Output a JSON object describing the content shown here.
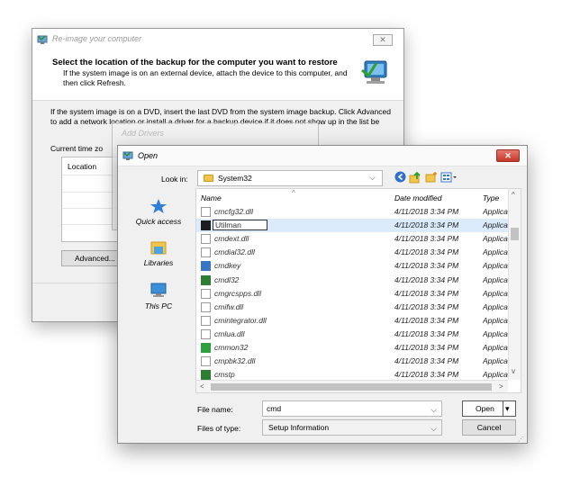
{
  "wizard": {
    "title": "Re-image your computer",
    "heading": "Select the location of the backup for the computer you want to restore",
    "subheading": "If the system image is on an external device, attach the device to this computer, and then click Refresh.",
    "body_text": "If the system image is on a DVD, insert the last DVD from the system image backup. Click Advanced to add a network location or install a driver for a backup device if it does not show up in the list be",
    "current_time_zone_label": "Current time zo",
    "location_header": "Location",
    "advanced_label": "Advanced..."
  },
  "add_drivers": {
    "title": "Add Drivers"
  },
  "open_dialog": {
    "title": "Open",
    "look_in_label": "Look in:",
    "look_in_value": "System32",
    "places": [
      {
        "label": "Quick access",
        "icon": "star-pin-icon"
      },
      {
        "label": "Libraries",
        "icon": "libraries-folder-icon"
      },
      {
        "label": "This PC",
        "icon": "computer-icon"
      }
    ],
    "columns": {
      "name": "Name",
      "date": "Date modified",
      "type": "Type"
    },
    "files": [
      {
        "name": "cmcfg32.dll",
        "date": "4/11/2018 3:34 PM",
        "type": "Application extension",
        "icon": "dll-file-icon"
      },
      {
        "name": "Utilman",
        "date": "4/11/2018 3:34 PM",
        "type": "Application",
        "icon": "console-icon"
      },
      {
        "name": "cmdext.dll",
        "date": "4/11/2018 3:34 PM",
        "type": "Application extension",
        "icon": "dll-file-icon"
      },
      {
        "name": "cmdial32.dll",
        "date": "4/11/2018 3:34 PM",
        "type": "Application extension",
        "icon": "dll-file-icon"
      },
      {
        "name": "cmdkey",
        "date": "4/11/2018 3:34 PM",
        "type": "Application",
        "icon": "exe-window-icon"
      },
      {
        "name": "cmdl32",
        "date": "4/11/2018 3:34 PM",
        "type": "Application",
        "icon": "cmdl32-icon"
      },
      {
        "name": "cmgrcspps.dll",
        "date": "4/11/2018 3:34 PM",
        "type": "Application extension",
        "icon": "dll-file-icon"
      },
      {
        "name": "cmifw.dll",
        "date": "4/11/2018 3:34 PM",
        "type": "Application extension",
        "icon": "dll-file-icon"
      },
      {
        "name": "cmintegrator.dll",
        "date": "4/11/2018 3:34 PM",
        "type": "Application extension",
        "icon": "dll-file-icon"
      },
      {
        "name": "cmlua.dll",
        "date": "4/11/2018 3:34 PM",
        "type": "Application extension",
        "icon": "dll-file-icon"
      },
      {
        "name": "cmmon32",
        "date": "4/11/2018 3:34 PM",
        "type": "Application",
        "icon": "cmmon-icon"
      },
      {
        "name": "cmpbk32.dll",
        "date": "4/11/2018 3:34 PM",
        "type": "Application extension",
        "icon": "dll-file-icon"
      },
      {
        "name": "cmstp",
        "date": "4/11/2018 3:34 PM",
        "type": "Application",
        "icon": "cmstp-icon"
      }
    ],
    "selected_index": 1,
    "file_name_label": "File name:",
    "file_name_value": "cmd",
    "files_of_type_label": "Files of type:",
    "files_of_type_value": "Setup Information",
    "open_label": "Open",
    "cancel_label": "Cancel"
  }
}
